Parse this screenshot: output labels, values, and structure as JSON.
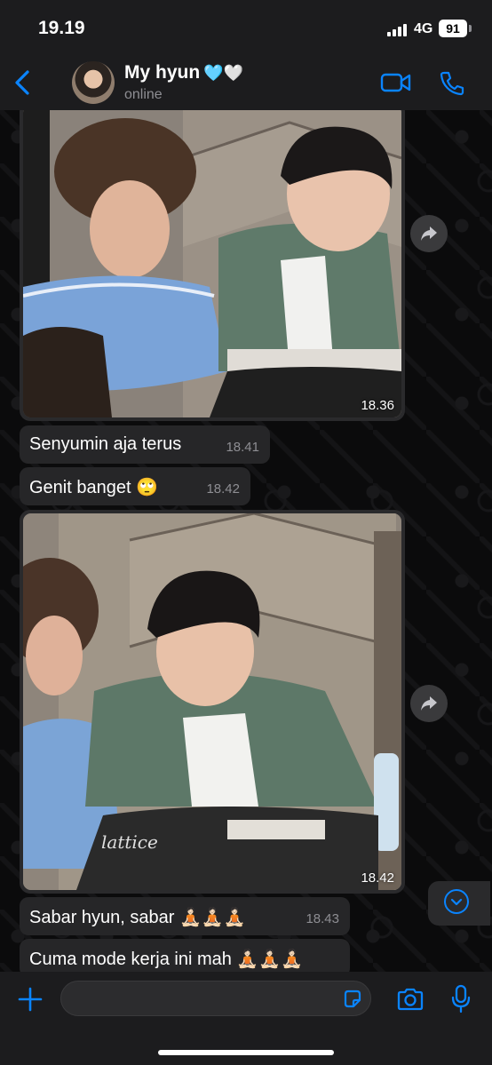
{
  "status_bar": {
    "time": "19.19",
    "network": "4G",
    "battery": "91"
  },
  "header": {
    "contact_name": "My hyun",
    "hearts": "🩵🤍",
    "status": "online"
  },
  "messages": [
    {
      "type": "image",
      "time": "18.36"
    },
    {
      "type": "text",
      "text": "Senyumin aja terus",
      "time": "18.41"
    },
    {
      "type": "text",
      "text": "Genit banget 🙄",
      "time": "18.42"
    },
    {
      "type": "image",
      "time": "18.42",
      "watermark": "lattice"
    },
    {
      "type": "text",
      "text": "Sabar hyun, sabar 🧘🏻🧘🏻🧘🏻",
      "time": "18.43"
    },
    {
      "type": "text",
      "text": "Cuma mode kerja ini mah 🧘🏻🧘🏻🧘🏻",
      "time": ""
    }
  ],
  "colors": {
    "accent": "#0a84ff",
    "bar_bg": "#1c1c1e",
    "bubble_bg": "#262628"
  },
  "icons": [
    "back-chevron-icon",
    "video-call-icon",
    "phone-call-icon",
    "forward-icon",
    "scroll-down-icon",
    "plus-icon",
    "sticker-icon",
    "camera-icon",
    "microphone-icon"
  ]
}
